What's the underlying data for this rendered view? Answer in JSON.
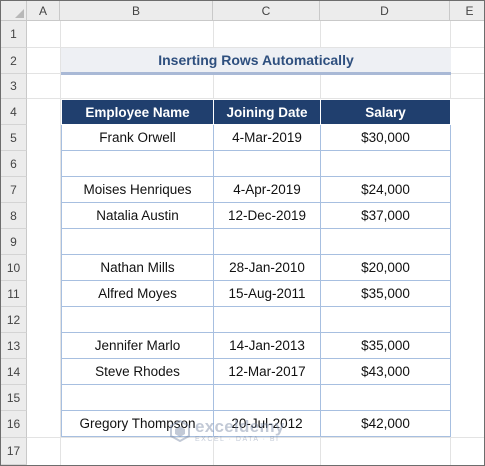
{
  "columns": [
    "A",
    "B",
    "C",
    "D",
    "E"
  ],
  "rows": [
    "1",
    "2",
    "3",
    "4",
    "5",
    "6",
    "7",
    "8",
    "9",
    "10",
    "11",
    "12",
    "13",
    "14",
    "15",
    "16",
    "17"
  ],
  "title": "Inserting Rows Automatically",
  "table": {
    "headers": [
      "Employee Name",
      "Joining Date",
      "Salary"
    ],
    "rows": [
      [
        "Frank Orwell",
        "4-Mar-2019",
        "$30,000"
      ],
      [
        "",
        "",
        ""
      ],
      [
        "Moises Henriques",
        "4-Apr-2019",
        "$24,000"
      ],
      [
        "Natalia Austin",
        "12-Dec-2019",
        "$37,000"
      ],
      [
        "",
        "",
        ""
      ],
      [
        "Nathan Mills",
        "28-Jan-2010",
        "$20,000"
      ],
      [
        "Alfred Moyes",
        "15-Aug-2011",
        "$35,000"
      ],
      [
        "",
        "",
        ""
      ],
      [
        "Jennifer Marlo",
        "14-Jan-2013",
        "$35,000"
      ],
      [
        "Steve Rhodes",
        "12-Mar-2017",
        "$43,000"
      ],
      [
        "",
        "",
        ""
      ],
      [
        "Gregory Thompson",
        "20-Jul-2012",
        "$42,000"
      ]
    ]
  },
  "watermark": {
    "main": "exceldemy",
    "sub": "EXCEL · DATA · BI"
  },
  "colors": {
    "header_fill": "#203f6e",
    "title_text": "#2e4f7e",
    "cell_border": "#a7bfe0"
  }
}
